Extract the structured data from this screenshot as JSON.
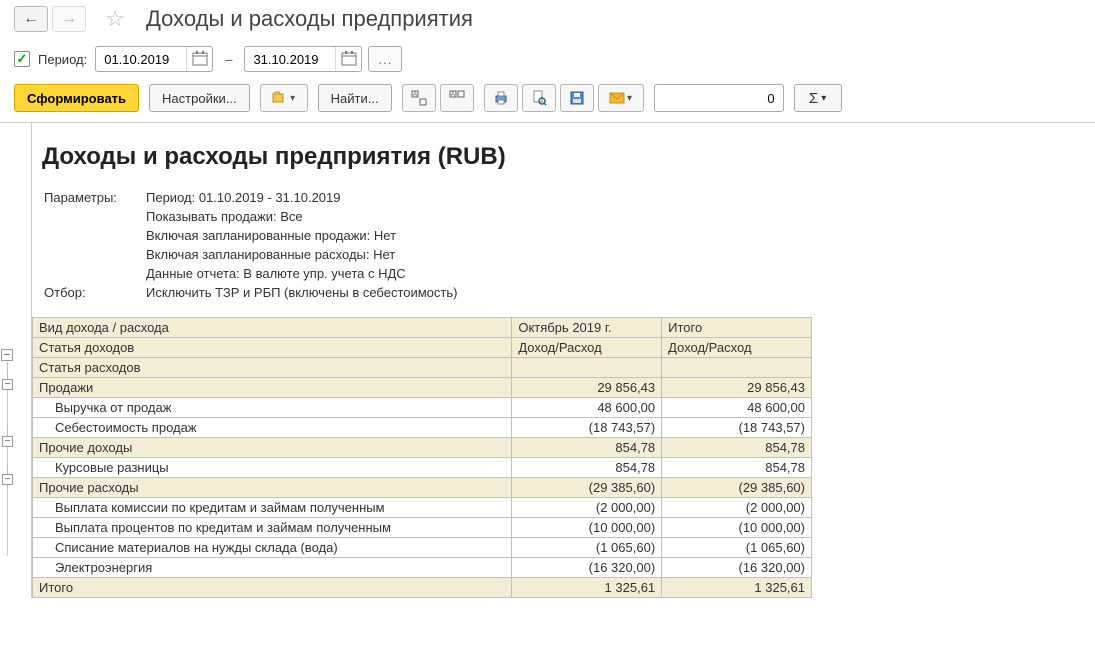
{
  "header": {
    "title": "Доходы и расходы предприятия"
  },
  "period": {
    "checkbox_label": "Период:",
    "from": "01.10.2019",
    "to": "31.10.2019",
    "dash": "–"
  },
  "toolbar": {
    "form_btn": "Сформировать",
    "settings_btn": "Настройки...",
    "find_btn": "Найти...",
    "num_value": "0",
    "sigma": "Σ"
  },
  "report": {
    "title": "Доходы и расходы предприятия (RUB)",
    "params_label": "Параметры:",
    "filter_label": "Отбор:",
    "param_lines": [
      "Период: 01.10.2019 - 31.10.2019",
      "Показывать продажи: Все",
      "Включая запланированные продажи: Нет",
      "Включая запланированные расходы: Нет",
      "Данные отчета: В валюте упр. учета с НДС"
    ],
    "filter_line": "Исключить ТЗР и РБП (включены в себестоимость)",
    "headers": {
      "c1a": "Вид дохода / расхода",
      "c1b": "Статья доходов",
      "c1c": "Статья расходов",
      "c2": "Октябрь 2019 г.",
      "c2sub": "Доход/Расход",
      "c3": "Итого",
      "c3sub": "Доход/Расход"
    },
    "rows": [
      {
        "kind": "sec",
        "name": "Продажи",
        "v1": "29 856,43",
        "v2": "29 856,43"
      },
      {
        "kind": "sub",
        "name": "Выручка от продаж",
        "v1": "48 600,00",
        "v2": "48 600,00"
      },
      {
        "kind": "sub",
        "name": "Себестоимость продаж",
        "v1": "(18 743,57)",
        "v2": "(18 743,57)"
      },
      {
        "kind": "sec",
        "name": "Прочие доходы",
        "v1": "854,78",
        "v2": "854,78"
      },
      {
        "kind": "sub",
        "name": "Курсовые разницы",
        "v1": "854,78",
        "v2": "854,78"
      },
      {
        "kind": "sec",
        "name": "Прочие расходы",
        "v1": "(29 385,60)",
        "v2": "(29 385,60)"
      },
      {
        "kind": "sub",
        "name": "Выплата комиссии по кредитам и займам полученным",
        "v1": "(2 000,00)",
        "v2": "(2 000,00)"
      },
      {
        "kind": "sub",
        "name": "Выплата процентов по кредитам и займам полученным",
        "v1": "(10 000,00)",
        "v2": "(10 000,00)"
      },
      {
        "kind": "sub",
        "name": "Списание материалов на нужды склада (вода)",
        "v1": "(1 065,60)",
        "v2": "(1 065,60)"
      },
      {
        "kind": "sub",
        "name": "Электроэнергия",
        "v1": "(16 320,00)",
        "v2": "(16 320,00)"
      },
      {
        "kind": "total",
        "name": "Итого",
        "v1": "1 325,61",
        "v2": "1 325,61"
      }
    ]
  }
}
